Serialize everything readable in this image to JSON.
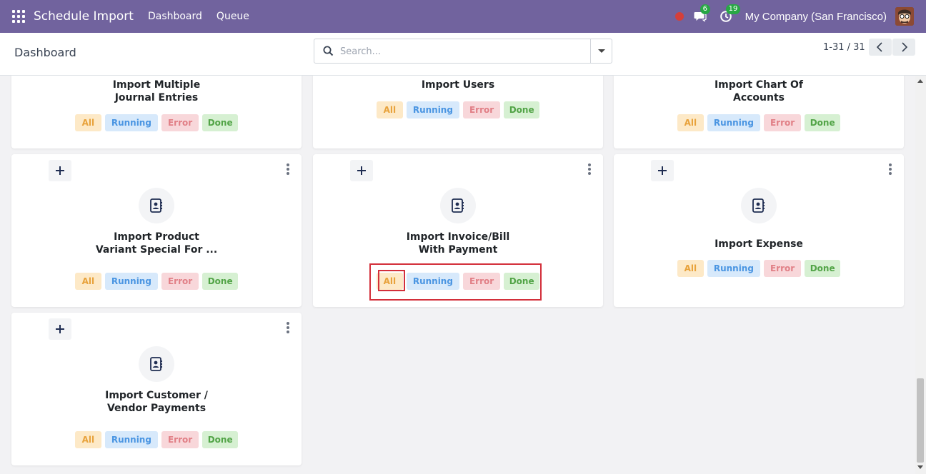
{
  "navbar": {
    "app_title": "Schedule Import",
    "menu": [
      "Dashboard",
      "Queue"
    ],
    "messages_count": "6",
    "activities_count": "19",
    "company": "My Company (San Francisco)"
  },
  "control_panel": {
    "title": "Dashboard",
    "search_placeholder": "Search...",
    "pager": "1-31 / 31"
  },
  "filters": {
    "all": "All",
    "running": "Running",
    "error": "Error",
    "done": "Done"
  },
  "cards": [
    {
      "title_lines": [
        "Import Multiple",
        "Journal Entries"
      ]
    },
    {
      "title_lines": [
        "Import Users"
      ]
    },
    {
      "title_lines": [
        "Import Chart Of",
        "Accounts"
      ]
    },
    {
      "title_lines": [
        "Import Product",
        "Variant Special For ..."
      ]
    },
    {
      "title_lines": [
        "Import Invoice/Bill",
        "With Payment"
      ]
    },
    {
      "title_lines": [
        "Import Expense"
      ]
    },
    {
      "title_lines": [
        "Import Customer /",
        "Vendor Payments"
      ]
    }
  ],
  "colors": {
    "navbar": "#71639e",
    "filter_all": "#e8a23b",
    "filter_running": "#4a95e2",
    "filter_error": "#e17f86",
    "filter_done": "#52a447",
    "highlight": "#d32f3a"
  }
}
